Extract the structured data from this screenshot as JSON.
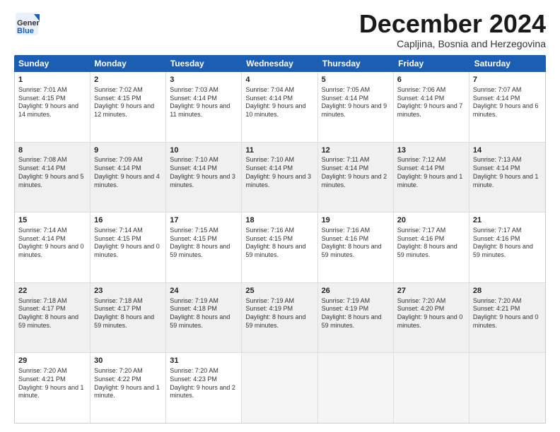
{
  "header": {
    "logo_general": "General",
    "logo_blue": "Blue",
    "month_title": "December 2024",
    "location": "Capljina, Bosnia and Herzegovina"
  },
  "days_of_week": [
    "Sunday",
    "Monday",
    "Tuesday",
    "Wednesday",
    "Thursday",
    "Friday",
    "Saturday"
  ],
  "rows": [
    [
      {
        "day": "1",
        "sunrise": "Sunrise: 7:01 AM",
        "sunset": "Sunset: 4:15 PM",
        "daylight": "Daylight: 9 hours and 14 minutes.",
        "shaded": false
      },
      {
        "day": "2",
        "sunrise": "Sunrise: 7:02 AM",
        "sunset": "Sunset: 4:15 PM",
        "daylight": "Daylight: 9 hours and 12 minutes.",
        "shaded": false
      },
      {
        "day": "3",
        "sunrise": "Sunrise: 7:03 AM",
        "sunset": "Sunset: 4:14 PM",
        "daylight": "Daylight: 9 hours and 11 minutes.",
        "shaded": false
      },
      {
        "day": "4",
        "sunrise": "Sunrise: 7:04 AM",
        "sunset": "Sunset: 4:14 PM",
        "daylight": "Daylight: 9 hours and 10 minutes.",
        "shaded": false
      },
      {
        "day": "5",
        "sunrise": "Sunrise: 7:05 AM",
        "sunset": "Sunset: 4:14 PM",
        "daylight": "Daylight: 9 hours and 9 minutes.",
        "shaded": false
      },
      {
        "day": "6",
        "sunrise": "Sunrise: 7:06 AM",
        "sunset": "Sunset: 4:14 PM",
        "daylight": "Daylight: 9 hours and 7 minutes.",
        "shaded": false
      },
      {
        "day": "7",
        "sunrise": "Sunrise: 7:07 AM",
        "sunset": "Sunset: 4:14 PM",
        "daylight": "Daylight: 9 hours and 6 minutes.",
        "shaded": false
      }
    ],
    [
      {
        "day": "8",
        "sunrise": "Sunrise: 7:08 AM",
        "sunset": "Sunset: 4:14 PM",
        "daylight": "Daylight: 9 hours and 5 minutes.",
        "shaded": true
      },
      {
        "day": "9",
        "sunrise": "Sunrise: 7:09 AM",
        "sunset": "Sunset: 4:14 PM",
        "daylight": "Daylight: 9 hours and 4 minutes.",
        "shaded": true
      },
      {
        "day": "10",
        "sunrise": "Sunrise: 7:10 AM",
        "sunset": "Sunset: 4:14 PM",
        "daylight": "Daylight: 9 hours and 3 minutes.",
        "shaded": true
      },
      {
        "day": "11",
        "sunrise": "Sunrise: 7:10 AM",
        "sunset": "Sunset: 4:14 PM",
        "daylight": "Daylight: 9 hours and 3 minutes.",
        "shaded": true
      },
      {
        "day": "12",
        "sunrise": "Sunrise: 7:11 AM",
        "sunset": "Sunset: 4:14 PM",
        "daylight": "Daylight: 9 hours and 2 minutes.",
        "shaded": true
      },
      {
        "day": "13",
        "sunrise": "Sunrise: 7:12 AM",
        "sunset": "Sunset: 4:14 PM",
        "daylight": "Daylight: 9 hours and 1 minute.",
        "shaded": true
      },
      {
        "day": "14",
        "sunrise": "Sunrise: 7:13 AM",
        "sunset": "Sunset: 4:14 PM",
        "daylight": "Daylight: 9 hours and 1 minute.",
        "shaded": true
      }
    ],
    [
      {
        "day": "15",
        "sunrise": "Sunrise: 7:14 AM",
        "sunset": "Sunset: 4:14 PM",
        "daylight": "Daylight: 9 hours and 0 minutes.",
        "shaded": false
      },
      {
        "day": "16",
        "sunrise": "Sunrise: 7:14 AM",
        "sunset": "Sunset: 4:15 PM",
        "daylight": "Daylight: 9 hours and 0 minutes.",
        "shaded": false
      },
      {
        "day": "17",
        "sunrise": "Sunrise: 7:15 AM",
        "sunset": "Sunset: 4:15 PM",
        "daylight": "Daylight: 8 hours and 59 minutes.",
        "shaded": false
      },
      {
        "day": "18",
        "sunrise": "Sunrise: 7:16 AM",
        "sunset": "Sunset: 4:15 PM",
        "daylight": "Daylight: 8 hours and 59 minutes.",
        "shaded": false
      },
      {
        "day": "19",
        "sunrise": "Sunrise: 7:16 AM",
        "sunset": "Sunset: 4:16 PM",
        "daylight": "Daylight: 8 hours and 59 minutes.",
        "shaded": false
      },
      {
        "day": "20",
        "sunrise": "Sunrise: 7:17 AM",
        "sunset": "Sunset: 4:16 PM",
        "daylight": "Daylight: 8 hours and 59 minutes.",
        "shaded": false
      },
      {
        "day": "21",
        "sunrise": "Sunrise: 7:17 AM",
        "sunset": "Sunset: 4:16 PM",
        "daylight": "Daylight: 8 hours and 59 minutes.",
        "shaded": false
      }
    ],
    [
      {
        "day": "22",
        "sunrise": "Sunrise: 7:18 AM",
        "sunset": "Sunset: 4:17 PM",
        "daylight": "Daylight: 8 hours and 59 minutes.",
        "shaded": true
      },
      {
        "day": "23",
        "sunrise": "Sunrise: 7:18 AM",
        "sunset": "Sunset: 4:17 PM",
        "daylight": "Daylight: 8 hours and 59 minutes.",
        "shaded": true
      },
      {
        "day": "24",
        "sunrise": "Sunrise: 7:19 AM",
        "sunset": "Sunset: 4:18 PM",
        "daylight": "Daylight: 8 hours and 59 minutes.",
        "shaded": true
      },
      {
        "day": "25",
        "sunrise": "Sunrise: 7:19 AM",
        "sunset": "Sunset: 4:19 PM",
        "daylight": "Daylight: 8 hours and 59 minutes.",
        "shaded": true
      },
      {
        "day": "26",
        "sunrise": "Sunrise: 7:19 AM",
        "sunset": "Sunset: 4:19 PM",
        "daylight": "Daylight: 8 hours and 59 minutes.",
        "shaded": true
      },
      {
        "day": "27",
        "sunrise": "Sunrise: 7:20 AM",
        "sunset": "Sunset: 4:20 PM",
        "daylight": "Daylight: 9 hours and 0 minutes.",
        "shaded": true
      },
      {
        "day": "28",
        "sunrise": "Sunrise: 7:20 AM",
        "sunset": "Sunset: 4:21 PM",
        "daylight": "Daylight: 9 hours and 0 minutes.",
        "shaded": true
      }
    ],
    [
      {
        "day": "29",
        "sunrise": "Sunrise: 7:20 AM",
        "sunset": "Sunset: 4:21 PM",
        "daylight": "Daylight: 9 hours and 1 minute.",
        "shaded": false
      },
      {
        "day": "30",
        "sunrise": "Sunrise: 7:20 AM",
        "sunset": "Sunset: 4:22 PM",
        "daylight": "Daylight: 9 hours and 1 minute.",
        "shaded": false
      },
      {
        "day": "31",
        "sunrise": "Sunrise: 7:20 AM",
        "sunset": "Sunset: 4:23 PM",
        "daylight": "Daylight: 9 hours and 2 minutes.",
        "shaded": false
      },
      {
        "day": "",
        "sunrise": "",
        "sunset": "",
        "daylight": "",
        "shaded": false,
        "empty": true
      },
      {
        "day": "",
        "sunrise": "",
        "sunset": "",
        "daylight": "",
        "shaded": false,
        "empty": true
      },
      {
        "day": "",
        "sunrise": "",
        "sunset": "",
        "daylight": "",
        "shaded": false,
        "empty": true
      },
      {
        "day": "",
        "sunrise": "",
        "sunset": "",
        "daylight": "",
        "shaded": false,
        "empty": true
      }
    ]
  ]
}
